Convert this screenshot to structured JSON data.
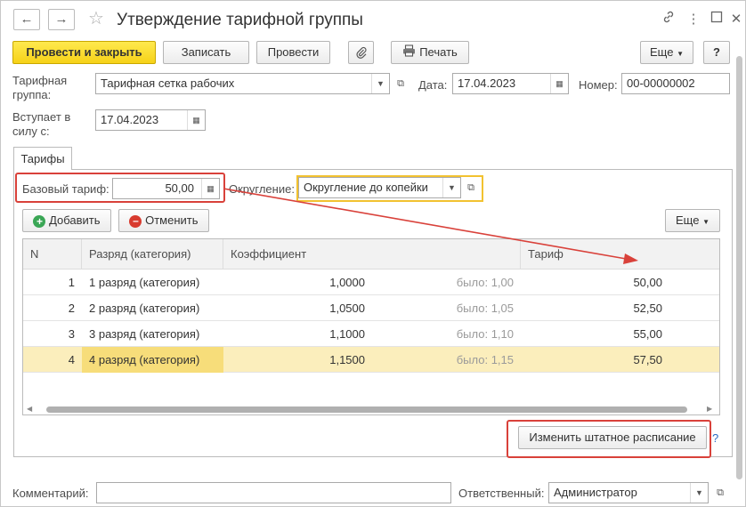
{
  "window": {
    "title": "Утверждение тарифной группы"
  },
  "toolbar": {
    "post_close": "Провести и закрыть",
    "save": "Записать",
    "post": "Провести",
    "print": "Печать",
    "more": "Еще",
    "help": "?"
  },
  "header": {
    "tariff_group_label": "Тарифная группа:",
    "tariff_group_value": "Тарифная сетка рабочих",
    "date_label": "Дата:",
    "date_value": "17.04.2023",
    "number_label": "Номер:",
    "number_value": "00-00000002",
    "effective_label": "Вступает в силу с:",
    "effective_value": "17.04.2023"
  },
  "tabs": [
    "Тарифы"
  ],
  "tariffs": {
    "base_label": "Базовый тариф:",
    "base_value": "50,00",
    "rounding_label": "Округление:",
    "rounding_value": "Округление до копейки",
    "add": "Добавить",
    "cancel": "Отменить",
    "more": "Еще"
  },
  "table": {
    "columns": [
      "N",
      "Разряд (категория)",
      "Коэффициент",
      "Тариф"
    ],
    "rows": [
      {
        "n": "1",
        "grade": "1 разряд (категория)",
        "coef": "1,0000",
        "was": "было: 1,00",
        "tariff": "50,00"
      },
      {
        "n": "2",
        "grade": "2 разряд (категория)",
        "coef": "1,0500",
        "was": "было: 1,05",
        "tariff": "52,50"
      },
      {
        "n": "3",
        "grade": "3 разряд (категория)",
        "coef": "1,1000",
        "was": "было: 1,10",
        "tariff": "55,00"
      },
      {
        "n": "4",
        "grade": "4 разряд (категория)",
        "coef": "1,1500",
        "was": "было: 1,15",
        "tariff": "57,50"
      }
    ]
  },
  "staff_button": "Изменить штатное расписание",
  "staff_help": "?",
  "footer": {
    "comment_label": "Комментарий:",
    "comment_value": "",
    "responsible_label": "Ответственный:",
    "responsible_value": "Администратор"
  },
  "colors": {
    "primary": "#f6d218",
    "highlight_red": "#d9413a",
    "highlight_yellow": "#f2c230",
    "selected_row": "#fbeebc",
    "add_icon": "#3aa655",
    "cancel_icon": "#d83b2f"
  }
}
